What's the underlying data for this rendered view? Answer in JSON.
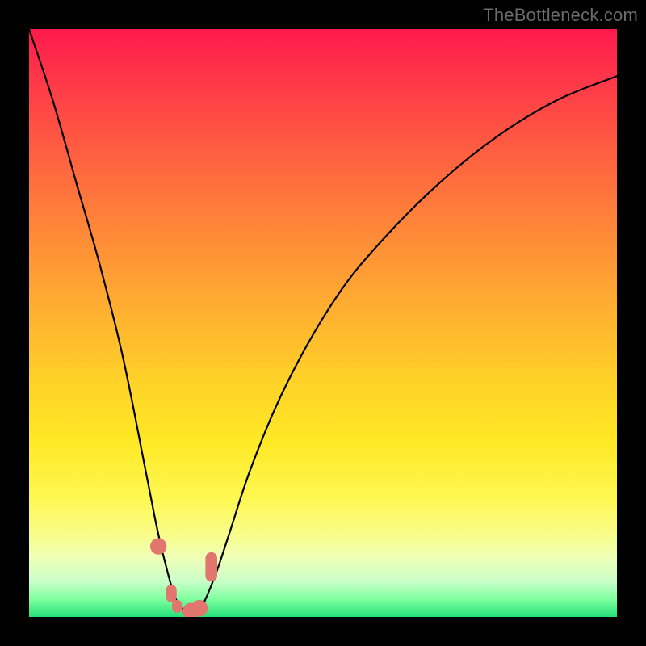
{
  "watermark": "TheBottleneck.com",
  "colors": {
    "frame": "#000000",
    "curve": "#000000",
    "marker": "#e0766d",
    "gradient_top": "#ff1a4d",
    "gradient_bottom": "#24e07a"
  },
  "chart_data": {
    "type": "line",
    "title": "",
    "xlabel": "",
    "ylabel": "",
    "xlim": [
      0,
      100
    ],
    "ylim": [
      0,
      100
    ],
    "annotations": [
      "TheBottleneck.com"
    ],
    "grid": false,
    "legend": false,
    "series": [
      {
        "name": "bottleneck-curve",
        "x": [
          0,
          4,
          8,
          12,
          16,
          20,
          22,
          24,
          25,
          26,
          27,
          28,
          29,
          30,
          32,
          34,
          38,
          44,
          52,
          60,
          70,
          80,
          90,
          100
        ],
        "y": [
          100,
          88,
          74,
          60,
          44,
          24,
          14,
          6,
          3,
          1.5,
          1,
          1,
          1.5,
          3,
          8,
          14,
          26,
          40,
          54,
          64,
          74,
          82,
          88,
          92
        ]
      }
    ],
    "markers": [
      {
        "shape": "circle",
        "x": 22.0,
        "y": 12.0,
        "r": 1.4
      },
      {
        "shape": "pill",
        "x": 24.2,
        "y": 4.0,
        "w": 1.8,
        "h": 3.0
      },
      {
        "shape": "pill",
        "x": 25.2,
        "y": 1.8,
        "w": 1.8,
        "h": 2.2
      },
      {
        "shape": "circle",
        "x": 27.5,
        "y": 1.0,
        "r": 1.4
      },
      {
        "shape": "circle",
        "x": 29.0,
        "y": 1.5,
        "r": 1.4
      },
      {
        "shape": "pill",
        "x": 31.0,
        "y": 8.5,
        "w": 2.0,
        "h": 5.0
      }
    ]
  }
}
